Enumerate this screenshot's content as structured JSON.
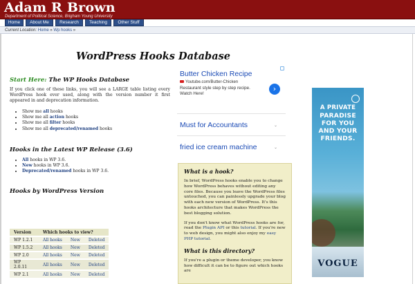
{
  "header": {
    "title": "Adam R Brown",
    "subtitle": "Department of Political Science, Brigham Young University"
  },
  "nav": {
    "tabs": [
      "Home",
      "About Me",
      "Research",
      "Teaching",
      "Other Stuff"
    ]
  },
  "breadcrumb": {
    "label": "Current Location:",
    "home": "Home",
    "sep": "»",
    "current": "Wp hooks",
    "end": "»"
  },
  "page": {
    "title": "WordPress Hooks Database"
  },
  "left": {
    "start_prefix": "Start Here:",
    "start_heading": " The WP Hooks Database",
    "intro": "If you click one of these links, you will see a LARGE table listing every WordPress hook ever used, along with the version number it first appeared in and deprecation information.",
    "links": [
      {
        "pre": "Show me ",
        "b": "all",
        "post": " hooks"
      },
      {
        "pre": "Show me all ",
        "b": "action",
        "post": " hooks"
      },
      {
        "pre": "Show me all ",
        "b": "filter",
        "post": " hooks"
      },
      {
        "pre": "Show me all ",
        "b": "deprecated/renamed",
        "post": " hooks"
      }
    ],
    "latest_heading": "Hooks in the Latest WP Release (3.6)",
    "latest": [
      {
        "b": "All",
        "post": " hooks in WP 3.6."
      },
      {
        "b": "New",
        "post": " hooks in WP 3.6."
      },
      {
        "b": "Deprecated/renamed",
        "post": " hooks in WP 3.6."
      }
    ],
    "byversion_heading": "Hooks by WordPress Version",
    "table": {
      "headers": [
        "Version",
        "Which hooks to view?"
      ],
      "rows": [
        [
          "WP 1.2.1",
          "All hooks",
          "New",
          "Deleted"
        ],
        [
          "WP 1.5.2",
          "All hooks",
          "New",
          "Deleted"
        ],
        [
          "WP 2.0",
          "All hooks",
          "New",
          "Deleted"
        ],
        [
          "WP 2.0.11",
          "All hooks",
          "New",
          "Deleted"
        ],
        [
          "WP 2.1",
          "All hooks",
          "New",
          "Deleted"
        ]
      ]
    }
  },
  "ads": {
    "first": {
      "title": "Butter Chicken Recipe",
      "url": "Youtube.com/Butter-Chicken",
      "desc": "Restaurant style step by step recipe. Watch Here!",
      "arrow": "›"
    },
    "second": {
      "title": "Must for Accountants",
      "chev": "⌄"
    },
    "third": {
      "title": "fried ice cream machine",
      "chev": "⌄"
    }
  },
  "info": {
    "h1": "What is a hook?",
    "p1": "In brief, WordPress hooks enable you to change how WordPress behaves without editing any core files. Because you leave the WordPress files untouched, you can painlessly upgrade your blog with each new version of WordPress. It's this hooks architecture that makes WordPress the best blogging solution.",
    "p2_a": "If you don't know what WordPress hooks are for, read the ",
    "p2_link1": "Plugin API",
    "p2_b": " or this ",
    "p2_link2": "tutorial",
    "p2_c": ". If you're new to web design, you might also enjoy my ",
    "p2_link3": "easy PHP tutorial",
    "p2_d": ".",
    "h2": "What is this directory?",
    "p3": "If you're a plugin or theme developer, you know how difficult it can be to figure out which hooks are"
  },
  "right_ad": {
    "line1": "A PRIVATE",
    "line2": "PARADISE",
    "line3": "FOR YOU",
    "line4": "AND YOUR",
    "line5": "FRIENDS.",
    "brand": "VOGUE"
  }
}
